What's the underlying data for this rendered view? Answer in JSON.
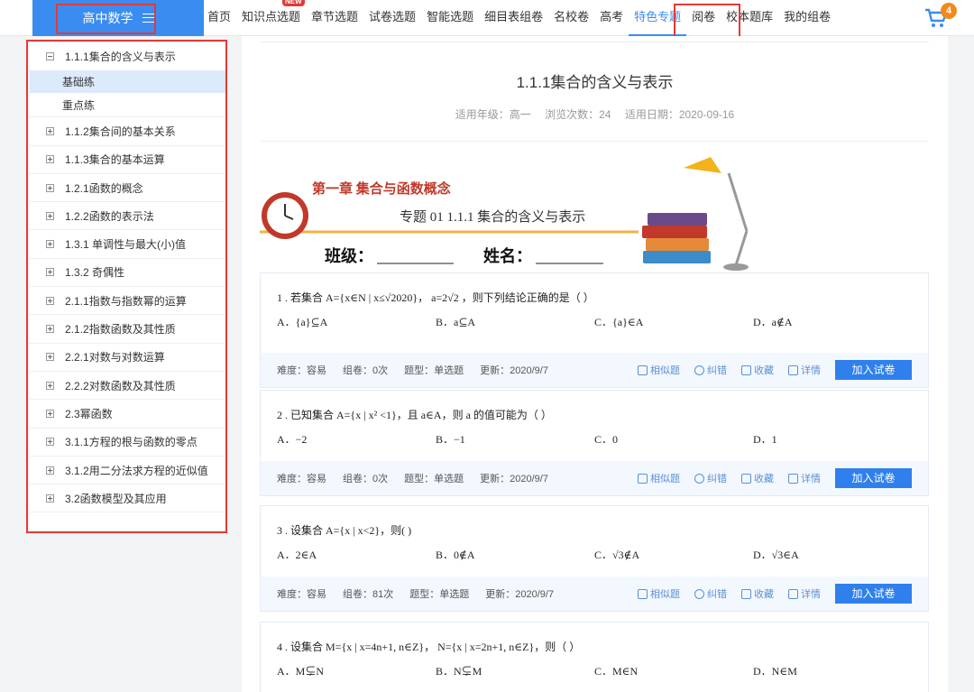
{
  "header": {
    "subject": "高中数学",
    "nav": [
      {
        "label": "首页",
        "badge": ""
      },
      {
        "label": "知识点选题",
        "badge": "NEW"
      },
      {
        "label": "章节选题",
        "badge": ""
      },
      {
        "label": "试卷选题",
        "badge": ""
      },
      {
        "label": "智能选题",
        "badge": ""
      },
      {
        "label": "细目表组卷",
        "badge": ""
      },
      {
        "label": "名校卷",
        "badge": ""
      },
      {
        "label": "高考",
        "badge": ""
      },
      {
        "label": "特色专题",
        "badge": ""
      },
      {
        "label": "阅卷",
        "badge": ""
      },
      {
        "label": "校本题库",
        "badge": ""
      },
      {
        "label": "我的组卷",
        "badge": ""
      }
    ],
    "active_nav": "特色专题",
    "cart_count": "4",
    "accent": "#3b8cf0"
  },
  "sidebar": {
    "items": [
      {
        "label": "1.1.1集合的含义与表示",
        "expanded": true,
        "children": [
          {
            "label": "基础练",
            "selected": true
          },
          {
            "label": "重点练",
            "selected": false
          }
        ]
      },
      {
        "label": "1.1.2集合间的基本关系"
      },
      {
        "label": "1.1.3集合的基本运算"
      },
      {
        "label": "1.2.1函数的概念"
      },
      {
        "label": "1.2.2函数的表示法"
      },
      {
        "label": "1.3.1 单调性与最大(小)值"
      },
      {
        "label": "1.3.2 奇偶性"
      },
      {
        "label": "2.1.1指数与指数幂的运算"
      },
      {
        "label": "2.1.2指数函数及其性质"
      },
      {
        "label": "2.2.1对数与对数运算"
      },
      {
        "label": "2.2.2对数函数及其性质"
      },
      {
        "label": "2.3幂函数"
      },
      {
        "label": "3.1.1方程的根与函数的零点"
      },
      {
        "label": "3.1.2用二分法求方程的近似值"
      },
      {
        "label": "3.2函数模型及其应用"
      }
    ]
  },
  "doc": {
    "title": "1.1.1集合的含义与表示",
    "meta": {
      "grade": "适用年级：高一",
      "views": "浏览次数：24",
      "date": "适用日期：2020-09-16"
    },
    "banner": {
      "chapter": "第一章  集合与函数概念",
      "topic": "专题 01  1.1.1    集合的含义与表示",
      "class_label": "班级：",
      "name_label": "姓名："
    }
  },
  "questions": [
    {
      "stem": "1 . 若集合 A={x∈N | x≤√2020}， a=2√2 ，则下列结论正确的是（  ）",
      "options": [
        "A．{a}⊆A",
        "B．a⊆A",
        "C．{a}∈A",
        "D．a∉A"
      ],
      "difficulty": "难度：容易",
      "uses": "组卷：0次",
      "type": "题型：单选题",
      "updated": "更新：2020/9/7"
    },
    {
      "stem": "2 . 已知集合 A={x | x² <1}，且 a∈A，则 a 的值可能为（  ）",
      "options": [
        "A．−2",
        "B．−1",
        "C．0",
        "D．1"
      ],
      "difficulty": "难度：容易",
      "uses": "组卷：0次",
      "type": "题型：单选题",
      "updated": "更新：2020/9/7"
    },
    {
      "stem": "3 . 设集合 A={x | x<2}，则(  )",
      "options": [
        "A．2∈A",
        "B．0∉A",
        "C．√3∉A",
        "D．√3∈A"
      ],
      "difficulty": "难度：容易",
      "uses": "组卷：81次",
      "type": "题型：单选题",
      "updated": "更新：2020/9/7"
    },
    {
      "stem": "4 . 设集合 M={x | x=4n+1, n∈Z}， N={x | x=2n+1, n∈Z}，则（  ）",
      "options": [
        "A．M⊊N",
        "B．N⊊M",
        "C．M∈N",
        "D．N∈M"
      ],
      "difficulty": "",
      "uses": "",
      "type": "",
      "updated": ""
    }
  ],
  "actions": {
    "similar": "相似题",
    "correct": "纠错",
    "collect": "收藏",
    "detail": "详情",
    "add": "加入试卷"
  }
}
